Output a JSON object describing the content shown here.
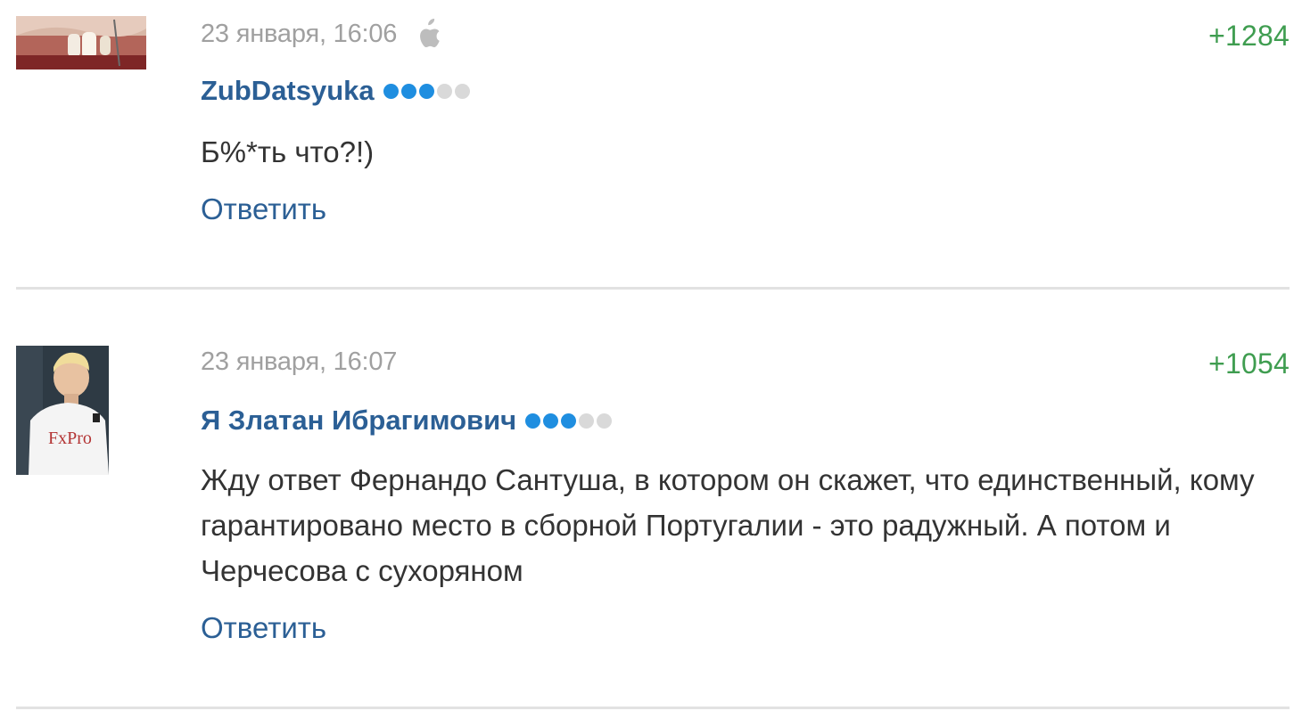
{
  "comments": [
    {
      "date": "23 января, 16:06",
      "platform_icon": "apple-icon",
      "score": "+1284",
      "username": "ZubDatsyuka",
      "rating": {
        "filled": 3,
        "total": 5
      },
      "text": "Б%*ть что?!)",
      "reply_label": "Ответить"
    },
    {
      "date": "23 января, 16:07",
      "score": "+1054",
      "username": "Я Златан Ибрагимович",
      "rating": {
        "filled": 3,
        "total": 5
      },
      "text": "Жду ответ Фернандо Сантуша, в котором он скажет, что единственный, кому гарантировано место в сборной Португалии - это радужный. А потом и Черчесова с сухоряном",
      "reply_label": "Ответить"
    }
  ],
  "colors": {
    "username": "#2b5f95",
    "score_positive": "#3f9d50",
    "date": "#a0a0a0",
    "rating_on": "#1f8ee0",
    "rating_off": "#d9d9d9",
    "divider": "#e2e2e2"
  }
}
